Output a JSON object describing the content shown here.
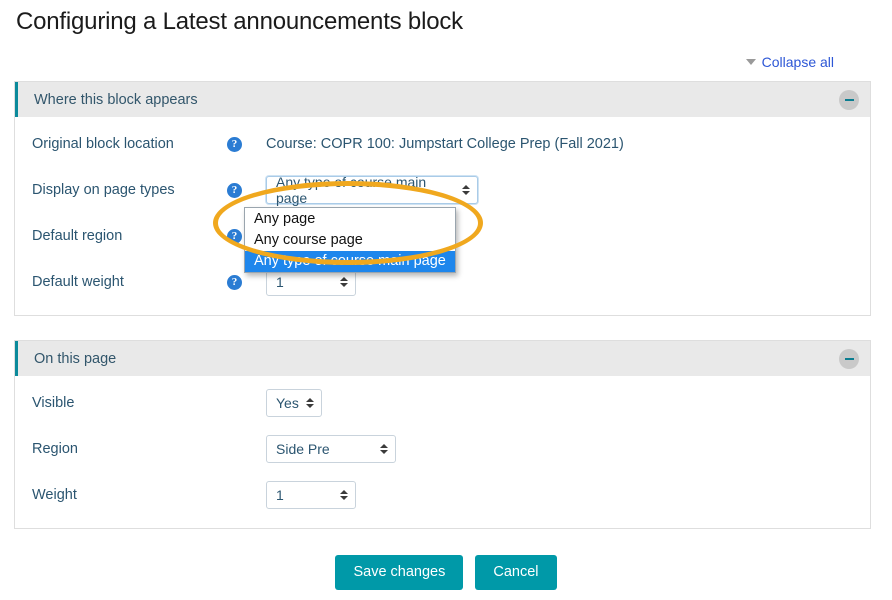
{
  "page": {
    "title": "Configuring a Latest announcements block"
  },
  "collapse_all": {
    "label": "Collapse all",
    "icon": "caret-down-icon"
  },
  "colors": {
    "accent_teal": "#0099a8",
    "header_border_teal": "#0b8a9b",
    "highlight_orange": "#f0a81e",
    "dropdown_selected_blue": "#1e86ec",
    "link_blue": "#2d57d6",
    "help_icon_blue": "#2b7cd3",
    "section_header_bg": "#e9e9e9"
  },
  "sections": [
    {
      "title": "Where this block appears",
      "collapse_icon": "minus-icon",
      "rows": [
        {
          "label": "Original block location",
          "help": "?",
          "type": "static",
          "value": "Course: COPR 100: Jumpstart College Prep (Fall 2021)"
        },
        {
          "label": "Display on page types",
          "help": "?",
          "type": "select-open",
          "value": "Any type of course main page",
          "options": [
            "Any page",
            "Any course page",
            "Any type of course main page"
          ],
          "selected_index": 2
        },
        {
          "label": "Default region",
          "help": "?",
          "type": "select-hidden",
          "value": ""
        },
        {
          "label": "Default weight",
          "help": "?",
          "type": "select",
          "value": "1"
        }
      ]
    },
    {
      "title": "On this page",
      "collapse_icon": "minus-icon",
      "rows": [
        {
          "label": "Visible",
          "help": "",
          "type": "select",
          "value": "Yes"
        },
        {
          "label": "Region",
          "help": "",
          "type": "select",
          "value": "Side Pre"
        },
        {
          "label": "Weight",
          "help": "",
          "type": "select",
          "value": "1"
        }
      ]
    }
  ],
  "buttons": {
    "save": "Save changes",
    "cancel": "Cancel"
  },
  "annotation": {
    "shape": "ellipse-highlight",
    "color": "#f0a81e"
  }
}
